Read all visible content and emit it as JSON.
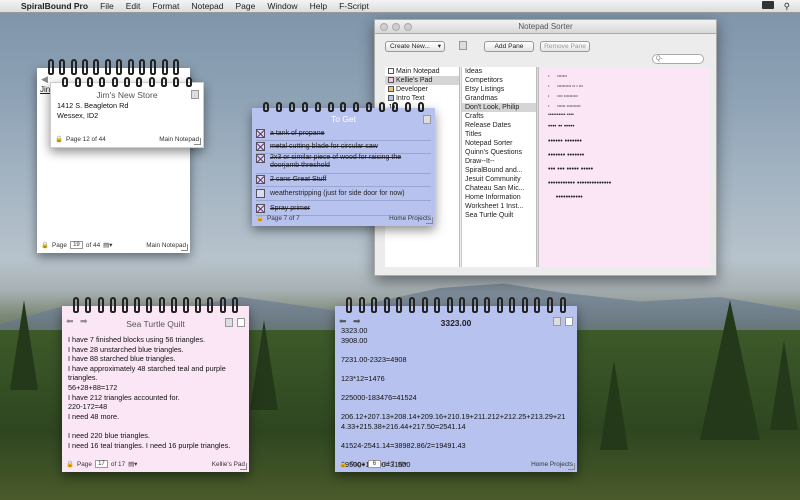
{
  "menubar": {
    "app": "SpiralBound Pro",
    "items": [
      "File",
      "Edit",
      "Format",
      "Notepad",
      "Page",
      "Window",
      "Help",
      "F-Script"
    ]
  },
  "pad_jims_back": {
    "partial_title": "Jin",
    "page_label": "Page",
    "page_value": "19",
    "of_label": "of 44",
    "notebook": "Main Notepad"
  },
  "pad_jims": {
    "title": "Jim's New Store",
    "lines": [
      "1412 S. Beagleton Rd",
      "Wessex, ID2"
    ],
    "page_text": "Page 12 of 44",
    "notebook": "Main Notepad"
  },
  "pad_toget": {
    "title": "To Get",
    "items": [
      {
        "text": "a tank of propane",
        "checked": true
      },
      {
        "text": "metal cutting blade for circular saw",
        "checked": true
      },
      {
        "text": "2x3 or similar piece of wood for raising the doorjamb threshold",
        "checked": true
      },
      {
        "text": "2 cans Great Stuff",
        "checked": true
      },
      {
        "text": "weatherstripping (just for side door for now)",
        "checked": false
      },
      {
        "text": "Spray primer",
        "checked": true
      }
    ],
    "page_text": "Page 7 of 7",
    "notebook": "Home Projects"
  },
  "sorter": {
    "title": "Notepad Sorter",
    "create_new": "Create New...",
    "add_pane": "Add Pane",
    "remove_pane": "Remove Pane",
    "search_placeholder": "Q-",
    "col1": [
      "Main Notepad",
      "Kellie's Pad",
      "Developer",
      "Intro Text",
      "Ja"
    ],
    "col2": [
      "Ideas",
      "Competitors",
      "Etsy Listings",
      "Grandmas",
      "Don't Look, Philip",
      "Crafts",
      "Release Dates",
      "Titles",
      "Notepad Sorter",
      "Quinn's Questions",
      "Draw--It--",
      "SpiralBound and...",
      "Jesuit Community",
      "Chateau San Mic...",
      "Home Information",
      "Worksheet 1 Inst...",
      "Sea Turtle Quilt"
    ]
  },
  "pad_quilt": {
    "title": "Sea Turtle Quilt",
    "lines": [
      "I have 7 finished blocks using 56 triangles.",
      "I have 28 unstarched blue triangles.",
      "I have 88 starched blue triangles.",
      "I have approximately 48 starched teal and purple triangles.",
      "56+28+88=172",
      "I have 212 triangles accounted for.",
      "220-172=48",
      "I need 48 more.",
      "",
      "I need 220 blue triangles.",
      "I need 16 teal triangles. I need 16 purple triangles."
    ],
    "page_label": "Page",
    "page_value": "17",
    "of_label": "of 17",
    "notebook": "Kellie's Pad"
  },
  "pad_calc": {
    "title": "3323.00",
    "lines": [
      "3323.00",
      "3908.00",
      "",
      "7231.00-2323=4908",
      "",
      "123*12=1476",
      "",
      "225000-183476=41524",
      "",
      "206.12+207.13+208.14+209.16+210.19+211.212+212.25+213.29+214.33+215.38+216.44+217.50=2541.14",
      "",
      "41524-2541.14=38982.86/2=19491.43",
      "",
      "19500+12000=31500"
    ],
    "page_label": "Page",
    "page_value": "6",
    "of_label": "of 7",
    "notebook": "Home Projects"
  },
  "colors": {
    "pink_pad": "#fbe6f5",
    "blue_pad": "#b8c2ee",
    "white_pad": "#ffffff"
  }
}
